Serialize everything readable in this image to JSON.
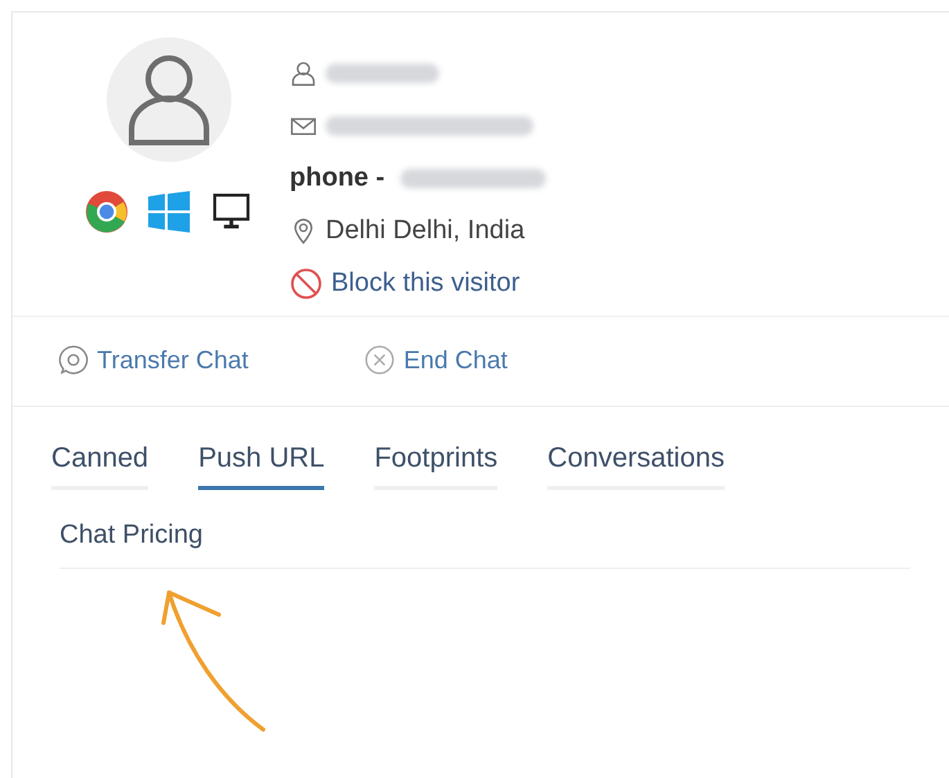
{
  "visitor": {
    "name_redacted": true,
    "email_redacted": true,
    "phone_label": "phone - ",
    "phone_redacted": true,
    "location": "Delhi Delhi, India",
    "block_action": "Block this visitor"
  },
  "actions": [
    {
      "kind": "transfer",
      "label": "Transfer Chat"
    },
    {
      "kind": "end",
      "label": "End Chat"
    }
  ],
  "tabs": [
    {
      "label": "Canned",
      "selected": false
    },
    {
      "label": "Push URL",
      "selected": true
    },
    {
      "label": "Footprints",
      "selected": false
    },
    {
      "label": "Conversations",
      "selected": false
    }
  ],
  "push_url_items": [
    "Chat Pricing"
  ]
}
